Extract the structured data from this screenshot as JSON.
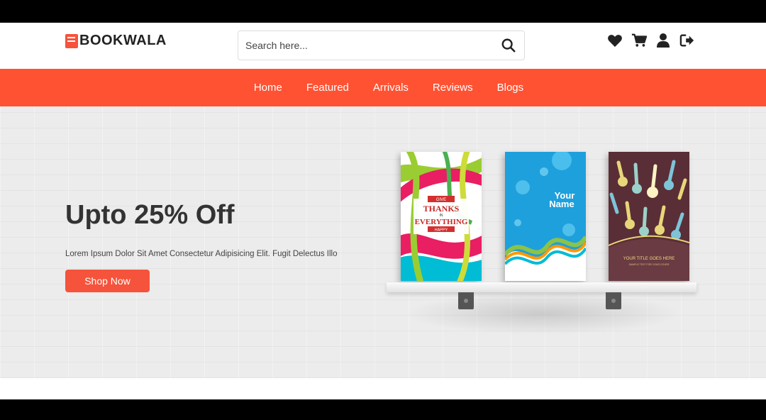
{
  "brand": {
    "name": "BOOKWALA",
    "accent": "#f5533b"
  },
  "search": {
    "placeholder": "Search here..."
  },
  "header_icons": [
    "heart-icon",
    "cart-icon",
    "user-icon",
    "logout-icon"
  ],
  "nav": {
    "items": [
      {
        "label": "Home"
      },
      {
        "label": "Featured"
      },
      {
        "label": "Arrivals"
      },
      {
        "label": "Reviews"
      },
      {
        "label": "Blogs"
      }
    ],
    "color": "#ff5233"
  },
  "hero": {
    "title": "Upto 25% Off",
    "description": "Lorem Ipsum Dolor Sit Amet Consectetur Adipisicing Elit. Fugit Delectus Illo",
    "cta_label": "Shop Now"
  },
  "books": [
    {
      "lines": [
        "GIVE",
        "THANKS",
        "IN",
        "EVERYTHING",
        "HAPPY"
      ]
    },
    {
      "lines": [
        "Your",
        "Name"
      ]
    },
    {
      "lines": [
        "YOUR TITLE GOES HERE",
        "SAMPLE TEXT FOR YOUR COVER"
      ]
    }
  ]
}
